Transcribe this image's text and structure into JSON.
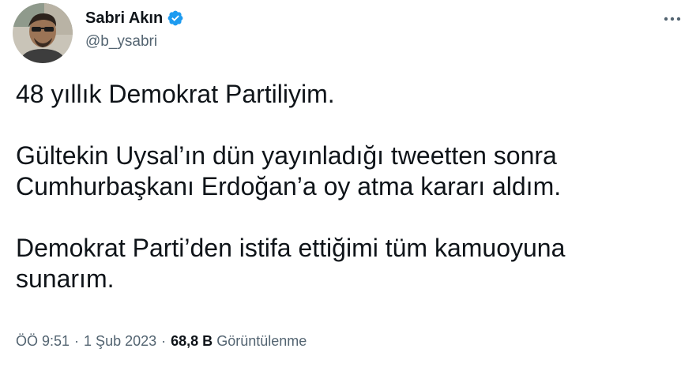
{
  "author": {
    "display_name": "Sabri Akın",
    "handle": "@b_ysabri",
    "verified": true,
    "verified_color": "#1d9bf0"
  },
  "more_icon": "more-options-icon",
  "tweet": {
    "paragraph_1": "48 yıllık Demokrat Partiliyim.",
    "paragraph_2_line_1": "Gültekin Uysal’ın dün yayınladığı tweetten sonra",
    "paragraph_2_line_2": "Cumhurbaşkanı Erdoğan’a oy atma kararı aldım.",
    "paragraph_3_line_1": "Demokrat Parti’den istifa ettiğimi tüm kamuoyuna",
    "paragraph_3_line_2": "sunarım."
  },
  "meta": {
    "time": "ÖÖ 9:51",
    "separator": "·",
    "date": "1 Şub 2023",
    "views_count": "68,8 B",
    "views_label": "Görüntülenme"
  },
  "colors": {
    "text_primary": "#0f1419",
    "text_secondary": "#536471",
    "background": "#ffffff"
  }
}
